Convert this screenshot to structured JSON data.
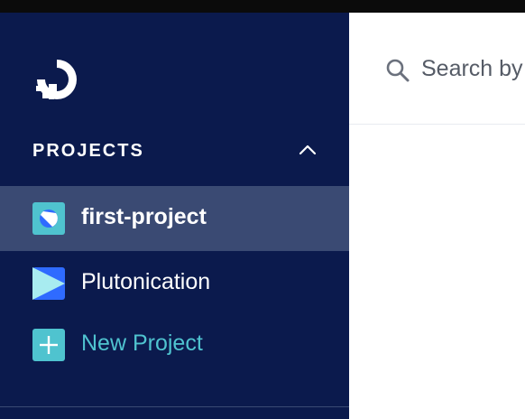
{
  "sidebar": {
    "logo_icon": "digitalocean-logo-icon",
    "section": {
      "title": "PROJECTS",
      "toggle_icon": "chevron-up-icon"
    },
    "projects": [
      {
        "label": "first-project",
        "icon": "project-circle-icon",
        "active": true
      },
      {
        "label": "Plutonication",
        "icon": "project-play-icon",
        "active": false
      }
    ],
    "new_project": {
      "label": "New Project",
      "icon": "plus-icon"
    }
  },
  "search": {
    "placeholder": "Search by resource name",
    "icon": "search-icon"
  },
  "colors": {
    "sidebar_bg": "#0b1a4d",
    "active_item_bg": "#3a4a73",
    "accent_teal": "#4fc3cf",
    "project_blue": "#2f6bff"
  }
}
